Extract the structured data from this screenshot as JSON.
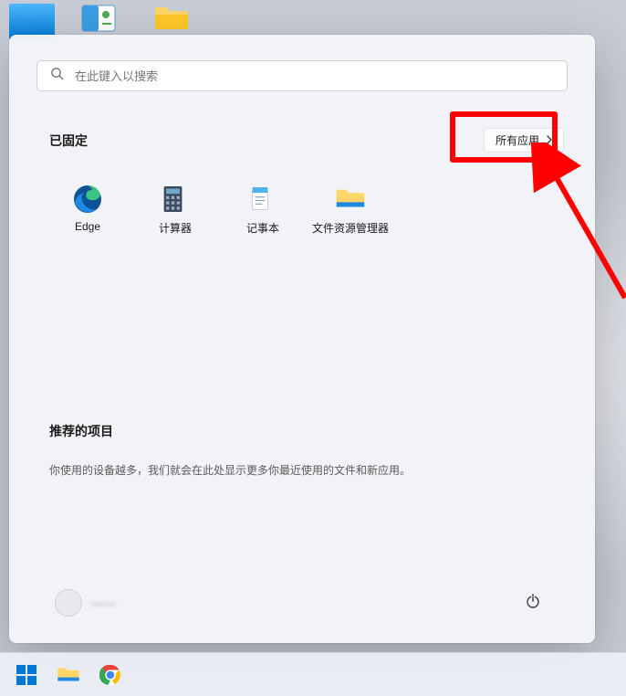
{
  "search": {
    "placeholder": "在此键入以搜索"
  },
  "pinned": {
    "title": "已固定",
    "all_apps_label": "所有应用",
    "apps": [
      {
        "label": "Edge"
      },
      {
        "label": "计算器"
      },
      {
        "label": "记事本"
      },
      {
        "label": "文件资源管理器"
      }
    ]
  },
  "recommended": {
    "title": "推荐的项目",
    "description": "你使用的设备越多，我们就会在此处显示更多你最近使用的文件和新应用。"
  },
  "user": {
    "name": "——"
  },
  "icons": {
    "search": "search-icon",
    "chevron_right": "chevron-right-icon",
    "power": "power-icon"
  },
  "colors": {
    "accent": "#0078d4",
    "annotation": "#ff0000",
    "panel_bg": "#f3f4f8"
  }
}
